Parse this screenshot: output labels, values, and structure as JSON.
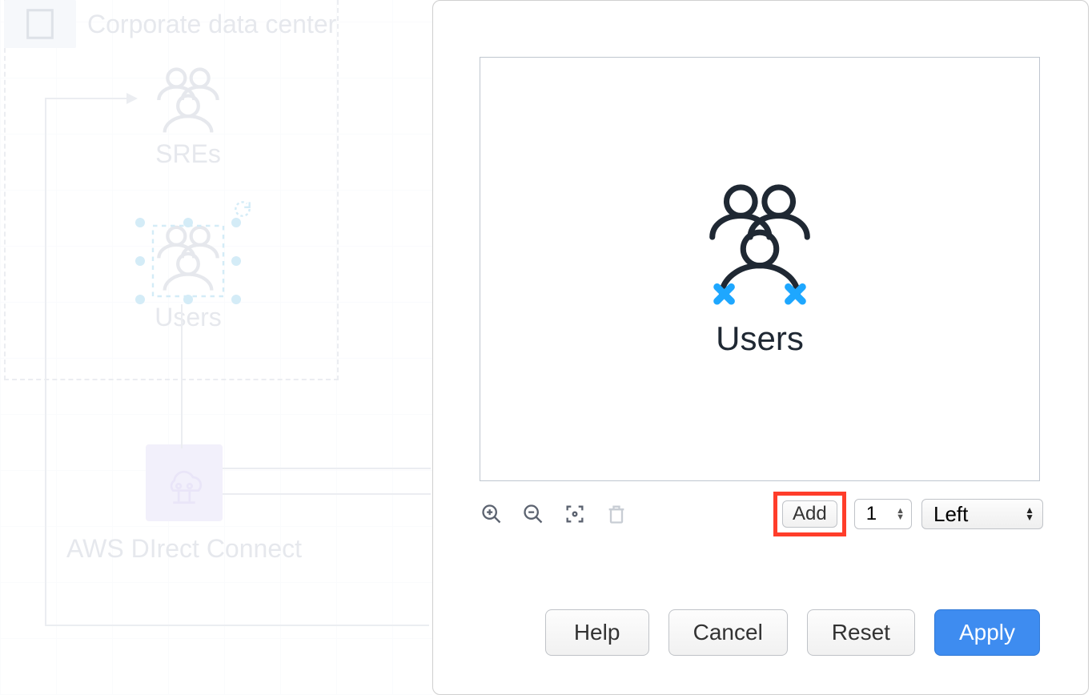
{
  "canvas": {
    "group_title": "Corporate data center",
    "nodes": {
      "sres": {
        "label": "SREs"
      },
      "users": {
        "label": "Users",
        "selected": true
      },
      "aws_direct_connect": {
        "label": "AWS DIrect Connect"
      }
    }
  },
  "dialog": {
    "preview_label": "Users",
    "toolbar": {
      "add_label": "Add",
      "count_value": "1",
      "position_value": "Left"
    },
    "footer": {
      "help": "Help",
      "cancel": "Cancel",
      "reset": "Reset",
      "apply": "Apply"
    }
  }
}
